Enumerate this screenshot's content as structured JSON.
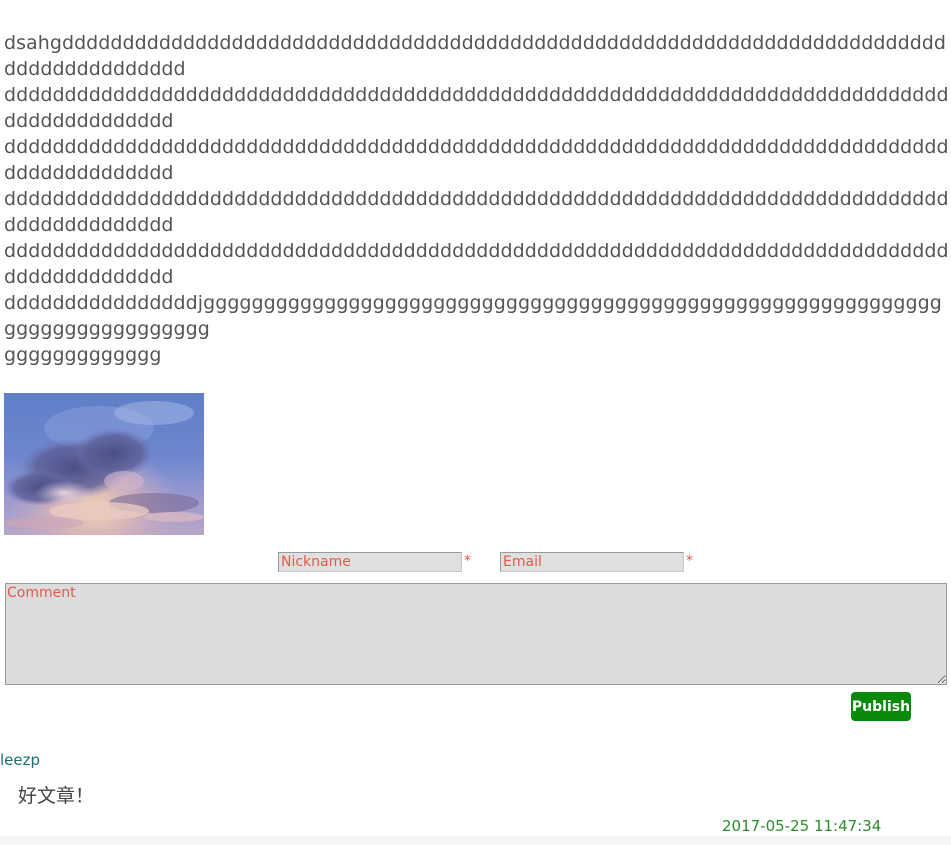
{
  "article": {
    "paragraphs": [
      "dsahgdddddddddddddddddddddddddddddddddddddddddddddddddddddddddddddddddddddddddddddddddddddddd",
      "dddddddddddddddddddddddddddddddddddddddddddddddddddddddddddddddddddddddddddddddddddddddddddd",
      "dddddddddddddddddddddddddddddddddddddddddddddddddddddddddddddddddddddddddddddddddddddddddddd",
      "dddddddddddddddddddddddddddddddddddddddddddddddddddddddddddddddddddddddddddddddddddddddddddd",
      "dddddddddddddddddddddddddddddddddddddddddddddddddddddddddddddddddddddddddddddddddddddddddddd",
      "ddddddddddddddddjgggggggggggggggggggggggggggggggggggggggggggggggggggggggggggggggggggggggggggggg",
      "ggggggggggggg"
    ]
  },
  "comment_form": {
    "nickname_placeholder": "Nickname",
    "email_placeholder": "Email",
    "required_mark": "*",
    "comment_placeholder": "Comment",
    "publish_label": "Publish"
  },
  "comments": [
    {
      "author": "leezp",
      "text": "好文章！",
      "timestamp": "2017-05-25 11:47:34"
    }
  ],
  "colors": {
    "publish_bg": "#0a8a0a",
    "placeholder": "#e05a4a",
    "author": "#1f6f6f",
    "timestamp": "#2e8b2e"
  }
}
